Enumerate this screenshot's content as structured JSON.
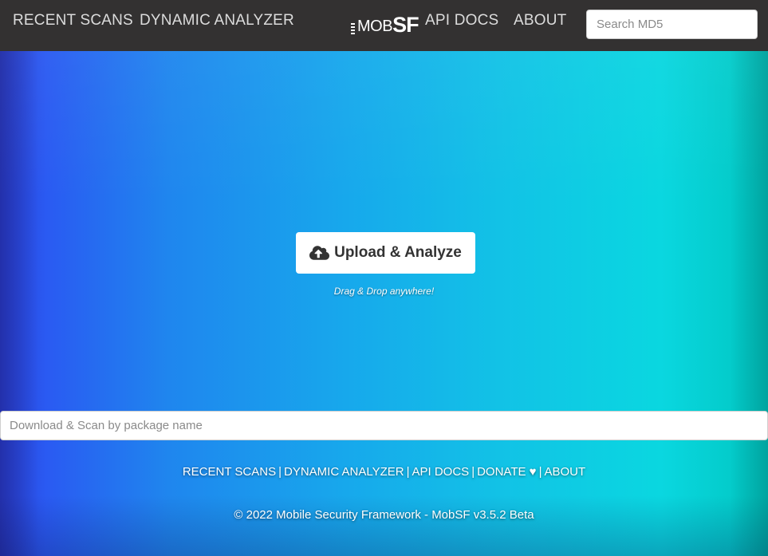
{
  "nav": {
    "recent_scans": "RECENT SCANS",
    "dynamic_analyzer": "DYNAMIC ANALYZER",
    "logo_mob": "MOB",
    "logo_sf": "SF",
    "api_docs": "API DOCS",
    "about": "ABOUT",
    "search_placeholder": "Search MD5"
  },
  "main": {
    "upload_label": "Upload & Analyze",
    "upload_icon": "cloud-upload-icon",
    "drag_hint": "Drag & Drop anywhere!",
    "package_placeholder": "Download & Scan by package name"
  },
  "footer": {
    "links": [
      "RECENT SCANS",
      "DYNAMIC ANALYZER",
      "API DOCS",
      "DONATE ♥",
      "ABOUT"
    ],
    "separator": "|",
    "copyright": "© 2022 Mobile Security Framework - MobSF v3.5.2 Beta"
  },
  "colors": {
    "navbar_bg": "#333131",
    "gradient_left": "#2a5af2",
    "gradient_right": "#0ad7e0"
  }
}
